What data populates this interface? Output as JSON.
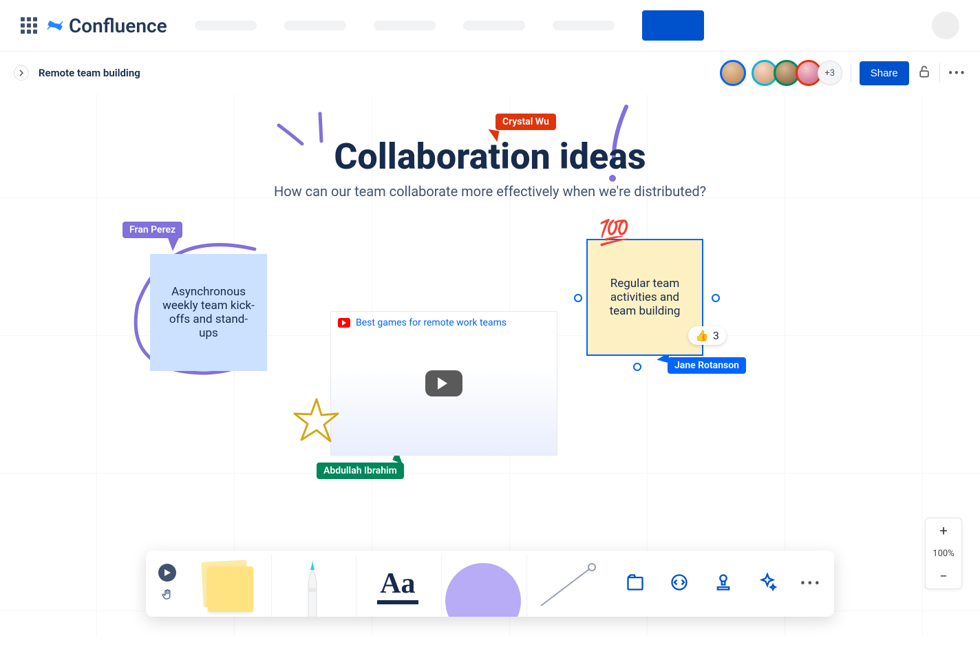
{
  "app": {
    "name": "Confluence"
  },
  "breadcrumb": "Remote team building",
  "collaborators": {
    "more_count": "+3"
  },
  "actions": {
    "share": "Share"
  },
  "board": {
    "title": "Collaboration ideas",
    "subtitle": "How can our team collaborate more effectively when we're distributed?"
  },
  "cursors": {
    "crystal": "Crystal Wu",
    "fran": "Fran Perez",
    "jane": "Jane Rotanson",
    "abdullah": "Abdullah Ibrahim"
  },
  "stickies": {
    "async": "Asynchronous weekly team kick-offs and stand-ups",
    "activities": "Regular team activities and team building"
  },
  "video": {
    "title": "Best games for remote work teams"
  },
  "reaction": {
    "emoji": "👍",
    "count": "3"
  },
  "hundred_emoji": "💯",
  "zoom": {
    "level": "100%"
  }
}
